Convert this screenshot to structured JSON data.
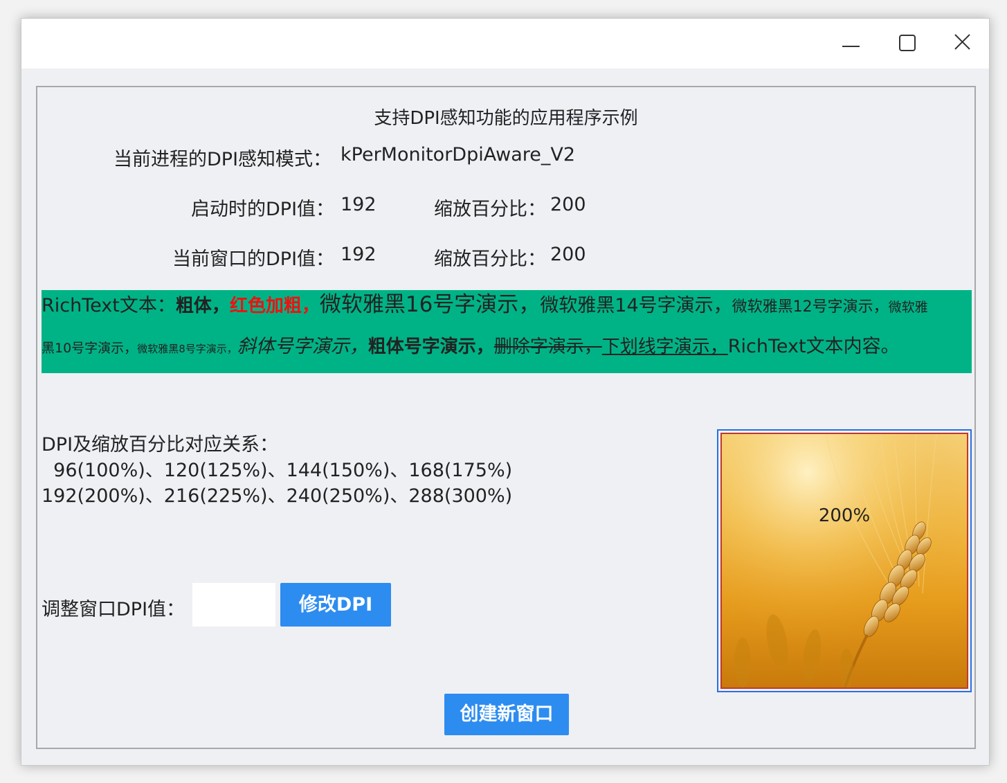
{
  "window": {
    "controls": {
      "minimize": "minimize-icon",
      "maximize": "maximize-icon",
      "close": "close-icon"
    }
  },
  "header": {
    "title": "支持DPI感知功能的应用程序示例"
  },
  "info": {
    "awareness_label": "当前进程的DPI感知模式：",
    "awareness_value": "kPerMonitorDpiAware_V2",
    "startup_dpi_label": "启动时的DPI值：",
    "startup_dpi_value": "192",
    "startup_scale_label": "缩放百分比：",
    "startup_scale_value": "200",
    "current_dpi_label": "当前窗口的DPI值：",
    "current_dpi_value": "192",
    "current_scale_label": "缩放百分比：",
    "current_scale_value": "200"
  },
  "richtext": {
    "background": "#00b386",
    "segments": {
      "intro": "RichText文本：",
      "bold": "粗体，",
      "red_bold": "红色加粗，",
      "yahei16": "微软雅黑16号字演示，",
      "yahei14": "微软雅黑14号字演示，",
      "yahei12": "微软雅黑12号字演示，",
      "yahei10a": "微软雅",
      "yahei10b": "黑10号字演示，",
      "yahei8": "微软雅黑8号字演示，",
      "italic": "斜体号字演示，",
      "bold2": "粗体号字演示，",
      "strike": "删除字演示，",
      "underline": "下划线字演示，",
      "ending": "RichText文本内容。"
    }
  },
  "mapping": {
    "title": "DPI及缩放百分比对应关系：",
    "line1": "  96(100%)、120(125%)、144(150%)、168(175%)",
    "line2": "192(200%)、216(225%)、240(250%)、288(300%)"
  },
  "image": {
    "label": "200%",
    "subject": "wheat-image"
  },
  "dpi_control": {
    "label": "调整窗口DPI值：",
    "input_value": "",
    "button_label": "修改DPI"
  },
  "footer": {
    "new_window_label": "创建新窗口"
  },
  "colors": {
    "accent": "#2d8cf0",
    "richtext_bg": "#00b386",
    "red": "#f01010",
    "image_border": "#2a6fe0"
  }
}
